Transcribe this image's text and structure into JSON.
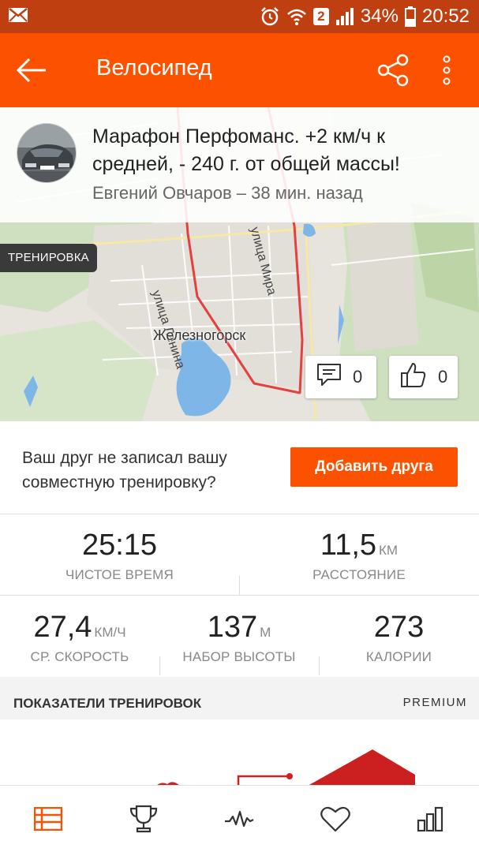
{
  "status_bar": {
    "battery": "34%",
    "time": "20:52",
    "sim": "2"
  },
  "app_bar": {
    "title": "Велосипед"
  },
  "activity": {
    "title": "Марафон Перфоманс.  +2 км/ч к средней, - 240 г. от общей массы!",
    "subtitle": "Евгений Овчаров – 38 мин. назад",
    "tag": "ТРЕНИРОВКА"
  },
  "map": {
    "city_label": "Железногорск",
    "street_1": "улица Ленина",
    "street_2": "улица Мира",
    "comments_count": "0",
    "kudos_count": "0"
  },
  "friend_prompt": {
    "text": "Ваш друг не записал вашу совместную тренировку?",
    "button": "Добавить друга"
  },
  "stats": {
    "moving_time": {
      "value": "25:15",
      "label": "ЧИСТОЕ ВРЕМЯ"
    },
    "distance": {
      "value": "11,5",
      "unit": "КМ",
      "label": "РАССТОЯНИЕ"
    },
    "avg_speed": {
      "value": "27,4",
      "unit": "КМ/Ч",
      "label": "СР. СКОРОСТЬ"
    },
    "elevation": {
      "value": "137",
      "unit": "М",
      "label": "НАБОР ВЫСОТЫ"
    },
    "calories": {
      "value": "273",
      "label": "КАЛОРИИ"
    }
  },
  "performance": {
    "title": "ПОКАЗАТЕЛИ ТРЕНИРОВОК",
    "badge": "PREMIUM"
  },
  "colors": {
    "brand": "#fc5200",
    "status_bar": "#bf3f10",
    "route": "#e34040"
  },
  "bottom_nav": [
    {
      "icon": "feed-icon",
      "active": true
    },
    {
      "icon": "trophy-icon"
    },
    {
      "icon": "record-activity-icon"
    },
    {
      "icon": "heart-icon"
    },
    {
      "icon": "stats-icon"
    }
  ]
}
